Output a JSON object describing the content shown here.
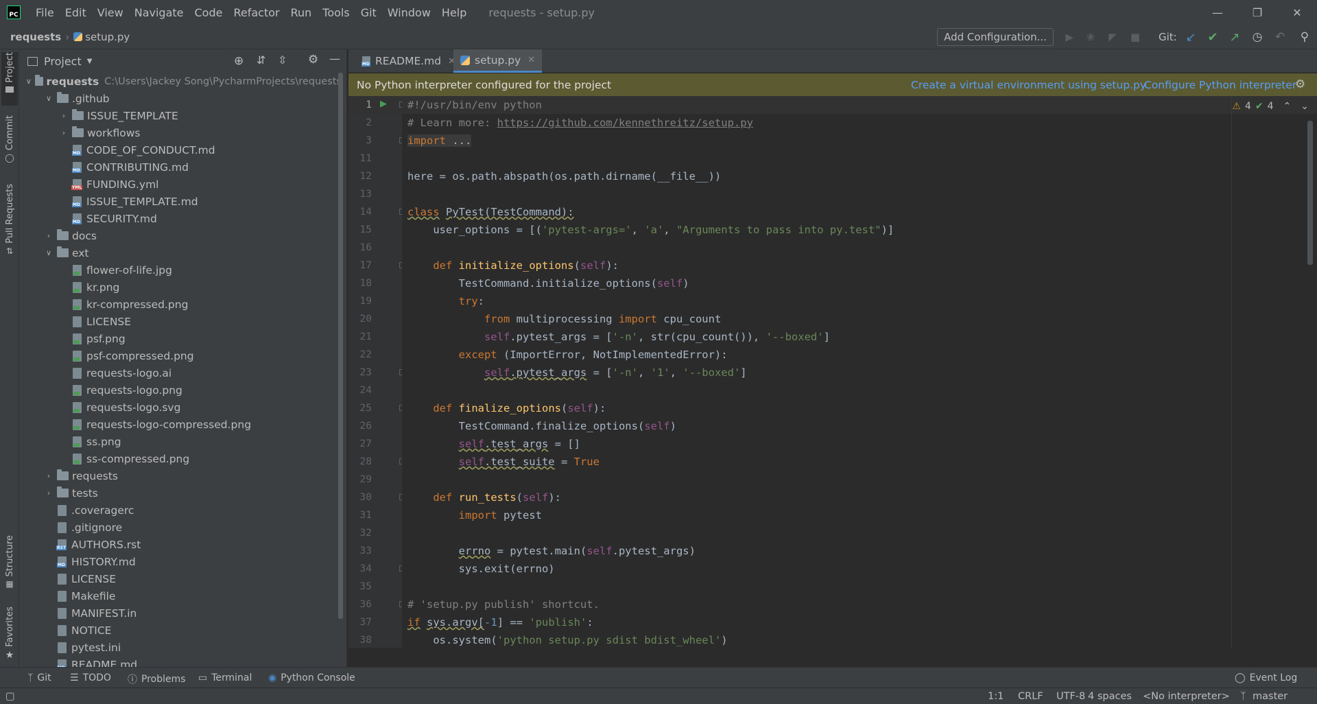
{
  "menubar": {
    "items": [
      "File",
      "Edit",
      "View",
      "Navigate",
      "Code",
      "Refactor",
      "Run",
      "Tools",
      "Git",
      "Window",
      "Help"
    ],
    "window_title": "requests - setup.py",
    "logo_text": "PC"
  },
  "navbar": {
    "crumb_root": "requests",
    "crumb_file": "setup.py",
    "add_config": "Add Configuration...",
    "git_label": "Git:"
  },
  "toolstrip": {
    "project": "Project",
    "commit": "Commit",
    "pull_requests": "Pull Requests",
    "structure": "Structure",
    "favorites": "Favorites"
  },
  "project_panel": {
    "title": "Project",
    "tree": [
      {
        "label": "requests",
        "path": "C:\\Users\\Jackey Song\\PycharmProjects\\requests",
        "type": "folder",
        "open": true,
        "depth": 0,
        "bold": true
      },
      {
        "label": ".github",
        "type": "folder",
        "open": true,
        "depth": 1
      },
      {
        "label": "ISSUE_TEMPLATE",
        "type": "folder",
        "open": false,
        "depth": 2
      },
      {
        "label": "workflows",
        "type": "folder",
        "open": false,
        "depth": 2
      },
      {
        "label": "CODE_OF_CONDUCT.md",
        "type": "md",
        "depth": 2
      },
      {
        "label": "CONTRIBUTING.md",
        "type": "md",
        "depth": 2
      },
      {
        "label": "FUNDING.yml",
        "type": "yml",
        "depth": 2
      },
      {
        "label": "ISSUE_TEMPLATE.md",
        "type": "md",
        "depth": 2
      },
      {
        "label": "SECURITY.md",
        "type": "md",
        "depth": 2
      },
      {
        "label": "docs",
        "type": "folder",
        "open": false,
        "depth": 1
      },
      {
        "label": "ext",
        "type": "folder",
        "open": true,
        "depth": 1
      },
      {
        "label": "flower-of-life.jpg",
        "type": "img",
        "depth": 2
      },
      {
        "label": "kr.png",
        "type": "img",
        "depth": 2
      },
      {
        "label": "kr-compressed.png",
        "type": "img",
        "depth": 2
      },
      {
        "label": "LICENSE",
        "type": "file",
        "depth": 2
      },
      {
        "label": "psf.png",
        "type": "img",
        "depth": 2
      },
      {
        "label": "psf-compressed.png",
        "type": "img",
        "depth": 2
      },
      {
        "label": "requests-logo.ai",
        "type": "file",
        "depth": 2
      },
      {
        "label": "requests-logo.png",
        "type": "img",
        "depth": 2
      },
      {
        "label": "requests-logo.svg",
        "type": "img",
        "depth": 2
      },
      {
        "label": "requests-logo-compressed.png",
        "type": "img",
        "depth": 2
      },
      {
        "label": "ss.png",
        "type": "img",
        "depth": 2
      },
      {
        "label": "ss-compressed.png",
        "type": "img",
        "depth": 2
      },
      {
        "label": "requests",
        "type": "folder",
        "open": false,
        "depth": 1
      },
      {
        "label": "tests",
        "type": "folder",
        "open": false,
        "depth": 1
      },
      {
        "label": ".coveragerc",
        "type": "file",
        "depth": 1
      },
      {
        "label": ".gitignore",
        "type": "file",
        "depth": 1
      },
      {
        "label": "AUTHORS.rst",
        "type": "rst",
        "depth": 1
      },
      {
        "label": "HISTORY.md",
        "type": "md",
        "depth": 1
      },
      {
        "label": "LICENSE",
        "type": "file",
        "depth": 1
      },
      {
        "label": "Makefile",
        "type": "file",
        "depth": 1
      },
      {
        "label": "MANIFEST.in",
        "type": "file",
        "depth": 1
      },
      {
        "label": "NOTICE",
        "type": "file",
        "depth": 1
      },
      {
        "label": "pytest.ini",
        "type": "file",
        "depth": 1
      },
      {
        "label": "README.md",
        "type": "md",
        "depth": 1
      }
    ]
  },
  "editor": {
    "tabs": [
      {
        "label": "README.md",
        "active": false
      },
      {
        "label": "setup.py",
        "active": true
      }
    ],
    "banner": {
      "message": "No Python interpreter configured for the project",
      "link_venv": "Create a virtual environment using setup.py",
      "link_config": "Configure Python interpreter"
    },
    "inspections": {
      "warnings": "4",
      "weak_warnings": "4"
    },
    "line_numbers": [
      "1",
      "2",
      "3",
      "11",
      "12",
      "13",
      "14",
      "15",
      "16",
      "17",
      "18",
      "19",
      "20",
      "21",
      "22",
      "23",
      "24",
      "25",
      "26",
      "27",
      "28",
      "29",
      "30",
      "31",
      "32",
      "33",
      "34",
      "35",
      "36",
      "37",
      "38"
    ]
  },
  "bottom_tools": {
    "git": "Git",
    "todo": "TODO",
    "problems": "Problems",
    "terminal": "Terminal",
    "python_console": "Python Console",
    "event_log": "Event Log"
  },
  "status": {
    "position": "1:1",
    "line_sep": "CRLF",
    "encoding": "UTF-8",
    "indent": "4 spaces",
    "interpreter": "<No interpreter>",
    "branch": "master"
  },
  "colors": {
    "accent": "#4a88c7",
    "banner_bg": "#5c5a30",
    "link": "#589df6",
    "keyword": "#cc7832",
    "string": "#6a8759",
    "function": "#ffc66d"
  }
}
